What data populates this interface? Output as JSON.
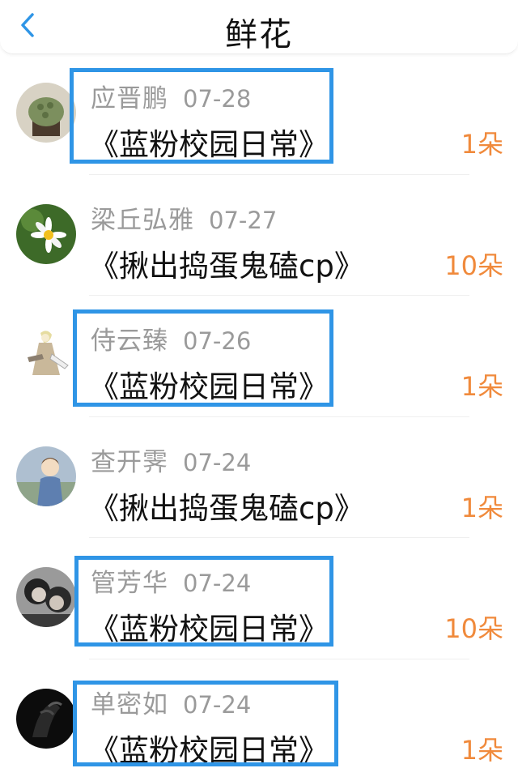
{
  "header": {
    "title": "鲜花",
    "back_icon": "chevron-left-icon",
    "accent": "#2f95e6"
  },
  "rows": [
    {
      "name": "应晋鹏",
      "date": "07-28",
      "work": "《蓝粉校园日常》",
      "count": "1朵",
      "avatar": "cupcake",
      "highlighted": true
    },
    {
      "name": "梁丘弘雅",
      "date": "07-27",
      "work": "《揪出捣蛋鬼磕cp》",
      "count": "10朵",
      "avatar": "daisy",
      "highlighted": false
    },
    {
      "name": "侍云臻",
      "date": "07-26",
      "work": "《蓝粉校园日常》",
      "count": "1朵",
      "avatar": "anime-figure",
      "highlighted": true
    },
    {
      "name": "查开霁",
      "date": "07-24",
      "work": "《揪出捣蛋鬼磕cp》",
      "count": "1朵",
      "avatar": "boy-illustration",
      "highlighted": false
    },
    {
      "name": "管芳华",
      "date": "07-24",
      "work": "《蓝粉校园日常》",
      "count": "10朵",
      "avatar": "couple-photo",
      "highlighted": true
    },
    {
      "name": "单密如",
      "date": "07-24",
      "work": "《蓝粉校园日常》",
      "count": "1朵",
      "avatar": "dark-hand",
      "highlighted": true
    }
  ],
  "colors": {
    "count": "#f08a3c",
    "meta": "#9a9a9a",
    "highlight_box": "#2f95e6"
  }
}
